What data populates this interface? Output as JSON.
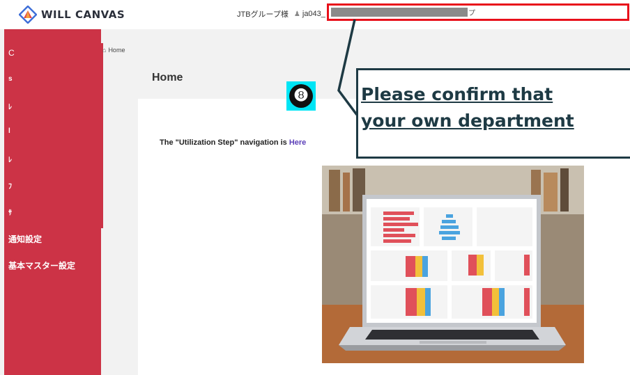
{
  "brand": {
    "name": "WILL CANVAS"
  },
  "header": {
    "company": "JTBグループ様",
    "user_id": "ja043_",
    "dept_tail": "プ"
  },
  "sidebar": {
    "letters": [
      "C",
      "s",
      "ﾚ",
      "l",
      "ﾚ",
      "ﾌ",
      "ｻ"
    ],
    "items": [
      {
        "label": "通知設定"
      },
      {
        "label": "基本マスター設定"
      }
    ]
  },
  "breadcrumb": {
    "home": "Home"
  },
  "page": {
    "title": "Home"
  },
  "content": {
    "util_prefix": "The \"Utilization Step\" navigation is ",
    "util_link": "Here"
  },
  "annotation": {
    "badge": "❽",
    "line1": "Please confirm that",
    "line2": "your own department"
  },
  "colors": {
    "sidebar": "#cc3346",
    "highlight": "#e8101a",
    "badge": "#00e5f5",
    "callout_text": "#1e3a44",
    "link": "#5b3fb8"
  }
}
